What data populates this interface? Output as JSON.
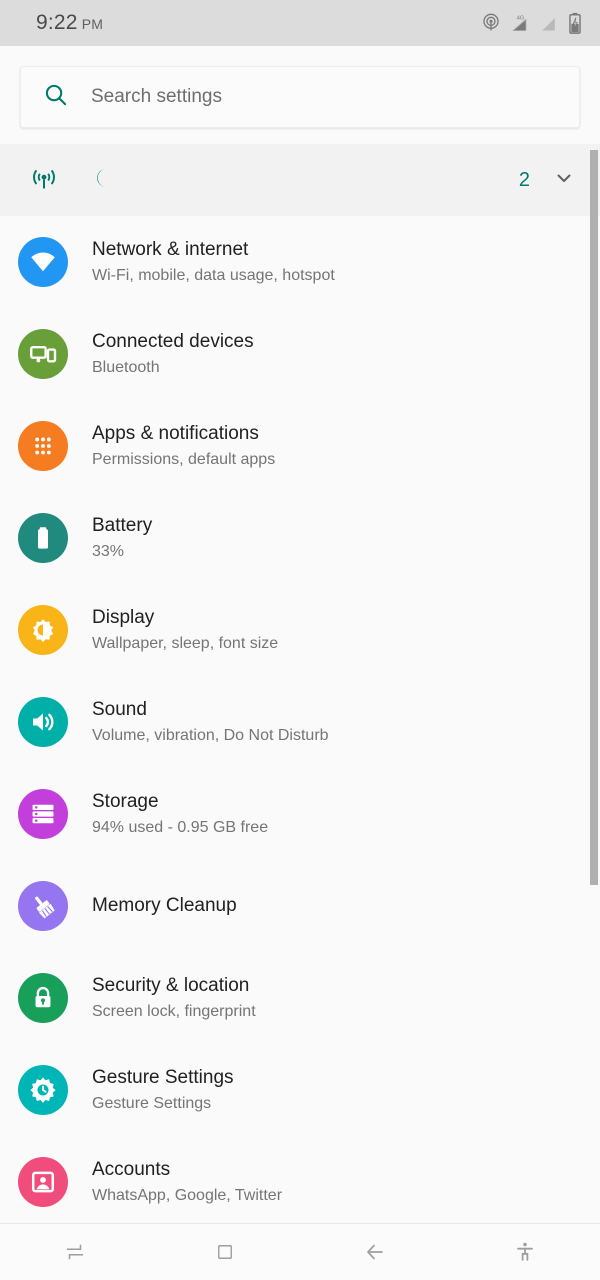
{
  "status_bar": {
    "time": "9:22",
    "ampm": "PM",
    "icons": [
      {
        "name": "hotspot-icon",
        "label": "hotspot"
      },
      {
        "name": "signal-4g-icon",
        "label": "4G"
      },
      {
        "name": "signal-icon",
        "label": "signal"
      },
      {
        "name": "battery-charging-icon",
        "label": "battery charging"
      }
    ]
  },
  "search": {
    "placeholder": "Search settings",
    "icon": "search-icon"
  },
  "suggestions": {
    "icons": [
      {
        "name": "hotspot-suggestion-icon",
        "label": "hotspot"
      },
      {
        "name": "night-mode-icon",
        "label": "night mode"
      }
    ],
    "count": "2",
    "expand_icon": "chevron-down-icon"
  },
  "settings": {
    "items": [
      {
        "title": "Network & internet",
        "subtitle": "Wi-Fi, mobile, data usage, hotspot",
        "icon": "wifi-icon",
        "color": "#2196f3"
      },
      {
        "title": "Connected devices",
        "subtitle": "Bluetooth",
        "icon": "connected-devices-icon",
        "color": "#689f38"
      },
      {
        "title": "Apps & notifications",
        "subtitle": "Permissions, default apps",
        "icon": "apps-grid-icon",
        "color": "#f57c20"
      },
      {
        "title": "Battery",
        "subtitle": "33%",
        "icon": "battery-icon",
        "color": "#1f8a7d"
      },
      {
        "title": "Display",
        "subtitle": "Wallpaper, sleep, font size",
        "icon": "brightness-icon",
        "color": "#f9b517"
      },
      {
        "title": "Sound",
        "subtitle": "Volume, vibration, Do Not Disturb",
        "icon": "volume-icon",
        "color": "#00b0a8"
      },
      {
        "title": "Storage",
        "subtitle": "94% used - 0.95 GB free",
        "icon": "storage-icon",
        "color": "#c23fdb"
      },
      {
        "title": "Memory Cleanup",
        "subtitle": "",
        "icon": "broom-icon",
        "color": "#9575f0"
      },
      {
        "title": "Security & location",
        "subtitle": "Screen lock, fingerprint",
        "icon": "lock-icon",
        "color": "#18a05a"
      },
      {
        "title": "Gesture Settings",
        "subtitle": "Gesture Settings",
        "icon": "gear-icon",
        "color": "#00b5b5"
      },
      {
        "title": "Accounts",
        "subtitle": "WhatsApp, Google, Twitter",
        "icon": "account-icon",
        "color": "#f04d7d"
      }
    ]
  },
  "nav_bar": {
    "buttons": [
      {
        "name": "switch-apps-button",
        "label": "switch apps"
      },
      {
        "name": "home-button",
        "label": "home"
      },
      {
        "name": "back-button",
        "label": "back"
      },
      {
        "name": "accessibility-button",
        "label": "accessibility"
      }
    ]
  },
  "theme": {
    "accent": "#00796b",
    "background": "#fafafa",
    "status_bar_bg": "#dcdcdc"
  }
}
